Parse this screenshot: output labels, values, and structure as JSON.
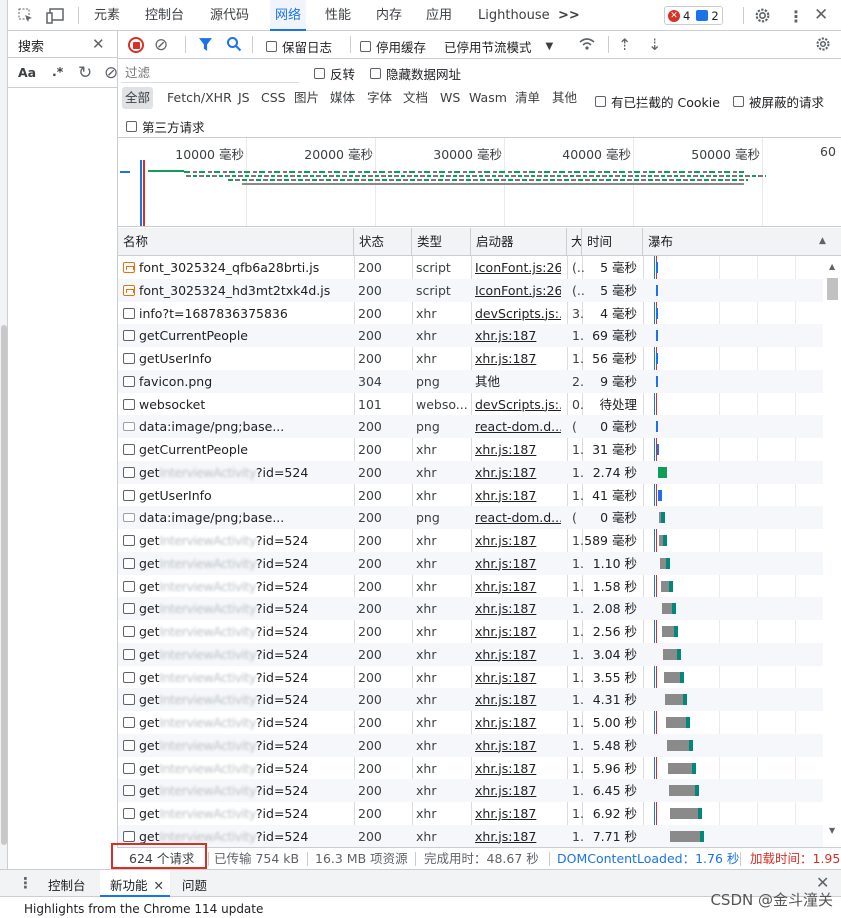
{
  "main_tabs": [
    "元素",
    "控制台",
    "源代码",
    "网络",
    "性能",
    "内存",
    "应用",
    "Lighthouse"
  ],
  "active_tab": "网络",
  "overflow_label": ">>",
  "error_count": "4",
  "message_count": "2",
  "search": {
    "title": "搜索",
    "opt_case": "Aa",
    "opt_regex": ".*"
  },
  "toolbar": {
    "preserve_log": "保留日志",
    "disable_cache": "停用缓存",
    "throttle": "已停用节流模式"
  },
  "filter": {
    "placeholder": "过滤",
    "invert": "反转",
    "hide_data_urls": "隐藏数据网址"
  },
  "types": [
    "全部",
    "Fetch/XHR",
    "JS",
    "CSS",
    "图片",
    "媒体",
    "字体",
    "文档",
    "WS",
    "Wasm",
    "清单",
    "其他"
  ],
  "blocked_cookies": "有已拦截的 Cookie",
  "blocked_requests": "被屏蔽的请求",
  "third_party": "第三方请求",
  "overview_ticks": [
    "10000 毫秒",
    "20000 毫秒",
    "30000 毫秒",
    "40000 毫秒",
    "50000 毫秒",
    "60"
  ],
  "columns": {
    "name": "名称",
    "status": "状态",
    "type": "类型",
    "initiator": "启动器",
    "size": "大",
    "time": "时间",
    "waterfall": "瀑布"
  },
  "rows": [
    {
      "name": "font_3025324_qfb6a28brti.js",
      "status": "200",
      "type": "script",
      "initiator": "IconFont.js:26",
      "size": "(..",
      "time": "5 毫秒",
      "icon": "font-file-icon",
      "wf": 0.4
    },
    {
      "name": "font_3025324_hd3mt2txk4d.js",
      "status": "200",
      "type": "script",
      "initiator": "IconFont.js:26",
      "size": "(..",
      "time": "5 毫秒",
      "icon": "font-file-icon",
      "wf": 0.4
    },
    {
      "name": "info?t=1687836375836",
      "status": "200",
      "type": "xhr",
      "initiator": "devScripts.js:...",
      "size": "3.",
      "time": "4 毫秒",
      "icon": "document-icon",
      "wf": 0.4
    },
    {
      "name": "getCurrentPeople",
      "status": "200",
      "type": "xhr",
      "initiator": "xhr.js:187",
      "size": "1.",
      "time": "69 毫秒",
      "icon": "document-icon",
      "wf": 0.6
    },
    {
      "name": "getUserInfo",
      "status": "200",
      "type": "xhr",
      "initiator": "xhr.js:187",
      "size": "1.",
      "time": "56 毫秒",
      "icon": "document-icon",
      "wf": 0.6
    },
    {
      "name": "favicon.png",
      "status": "304",
      "type": "png",
      "initiator": "其他",
      "size": "2.",
      "time": "9 毫秒",
      "icon": "document-icon",
      "wf": 0.6,
      "plain": true
    },
    {
      "name": "websocket",
      "status": "101",
      "type": "webso...",
      "initiator": "devScripts.js:...",
      "size": "0.",
      "time": "待处理",
      "icon": "document-icon",
      "wf": 0
    },
    {
      "name": "data:image/png;base...",
      "status": "200",
      "type": "png",
      "initiator": "react-dom.d...",
      "size": "(",
      "time": "0 毫秒",
      "icon": "image-icon",
      "wf": 0.3
    },
    {
      "name": "getCurrentPeople",
      "status": "200",
      "type": "xhr",
      "initiator": "xhr.js:187",
      "size": "1.",
      "time": "31 毫秒",
      "icon": "document-icon",
      "wf": 0.8
    },
    {
      "name": "getInterviewActivity?id=524",
      "status": "200",
      "type": "xhr",
      "initiator": "xhr.js:187",
      "size": "1.",
      "time": "2.74 秒",
      "icon": "document-icon",
      "wf": 1.2
    },
    {
      "name": "getUserInfo",
      "status": "200",
      "type": "xhr",
      "initiator": "xhr.js:187",
      "size": "1.",
      "time": "41 毫秒",
      "icon": "document-icon",
      "wf": 1.4
    },
    {
      "name": "data:image/png;base...",
      "status": "200",
      "type": "png",
      "initiator": "react-dom.d...",
      "size": "(",
      "time": "0 毫秒",
      "icon": "image-icon",
      "wf": 1.6
    },
    {
      "name": "getInterviewActivity?id=524",
      "status": "200",
      "type": "xhr",
      "initiator": "xhr.js:187",
      "size": "1.",
      "time": "589 毫秒",
      "icon": "document-icon",
      "wf": 1.8
    },
    {
      "name": "getInterviewActivity?id=524",
      "status": "200",
      "type": "xhr",
      "initiator": "xhr.js:187",
      "size": "1.",
      "time": "1.10 秒",
      "icon": "document-icon",
      "wf": 2.2
    },
    {
      "name": "getInterviewActivity?id=524",
      "status": "200",
      "type": "xhr",
      "initiator": "xhr.js:187",
      "size": "1.",
      "time": "1.58 秒",
      "icon": "document-icon",
      "wf": 2.6
    },
    {
      "name": "getInterviewActivity?id=524",
      "status": "200",
      "type": "xhr",
      "initiator": "xhr.js:187",
      "size": "1.",
      "time": "2.08 秒",
      "icon": "document-icon",
      "wf": 3.0
    },
    {
      "name": "getInterviewActivity?id=524",
      "status": "200",
      "type": "xhr",
      "initiator": "xhr.js:187",
      "size": "1.",
      "time": "2.56 秒",
      "icon": "document-icon",
      "wf": 3.4
    },
    {
      "name": "getInterviewActivity?id=524",
      "status": "200",
      "type": "xhr",
      "initiator": "xhr.js:187",
      "size": "1.",
      "time": "3.04 秒",
      "icon": "document-icon",
      "wf": 3.8
    },
    {
      "name": "getInterviewActivity?id=524",
      "status": "200",
      "type": "xhr",
      "initiator": "xhr.js:187",
      "size": "1.",
      "time": "3.55 秒",
      "icon": "document-icon",
      "wf": 4.2
    },
    {
      "name": "getInterviewActivity?id=524",
      "status": "200",
      "type": "xhr",
      "initiator": "xhr.js:187",
      "size": "1.",
      "time": "4.31 秒",
      "icon": "document-icon",
      "wf": 4.6
    },
    {
      "name": "getInterviewActivity?id=524",
      "status": "200",
      "type": "xhr",
      "initiator": "xhr.js:187",
      "size": "1.",
      "time": "5.00 秒",
      "icon": "document-icon",
      "wf": 5.0
    },
    {
      "name": "getInterviewActivity?id=524",
      "status": "200",
      "type": "xhr",
      "initiator": "xhr.js:187",
      "size": "1.",
      "time": "5.48 秒",
      "icon": "document-icon",
      "wf": 5.4
    },
    {
      "name": "getInterviewActivity?id=524",
      "status": "200",
      "type": "xhr",
      "initiator": "xhr.js:187",
      "size": "1.",
      "time": "5.96 秒",
      "icon": "document-icon",
      "wf": 5.8
    },
    {
      "name": "getInterviewActivity?id=524",
      "status": "200",
      "type": "xhr",
      "initiator": "xhr.js:187",
      "size": "1.",
      "time": "6.45 秒",
      "icon": "document-icon",
      "wf": 6.2
    },
    {
      "name": "getInterviewActivity?id=524",
      "status": "200",
      "type": "xhr",
      "initiator": "xhr.js:187",
      "size": "1.",
      "time": "6.92 秒",
      "icon": "document-icon",
      "wf": 6.6
    },
    {
      "name": "getInterviewActivity?id=524",
      "status": "200",
      "type": "xhr",
      "initiator": "xhr.js:187",
      "size": "1.",
      "time": "7.71 秒",
      "icon": "document-icon",
      "wf": 7.0
    }
  ],
  "statusbar": {
    "requests": "624 个请求",
    "transferred": "已传输 754 kB",
    "resources": "16.3 MB 项资源",
    "finish": "完成用时：48.67 秒",
    "dcl": "DOMContentLoaded：1.76 秒",
    "load": "加载时间：1.95"
  },
  "drawer": {
    "tabs": [
      "控制台",
      "新功能",
      "问题"
    ],
    "active": "新功能",
    "content": "Highlights from the Chrome 114 update"
  },
  "watermark": "CSDN @金斗潼关",
  "colors": {
    "accent": "#1a73e8",
    "record_red": "#d93025",
    "dcl_blue": "#1a73e8",
    "load_red": "#d93025"
  }
}
